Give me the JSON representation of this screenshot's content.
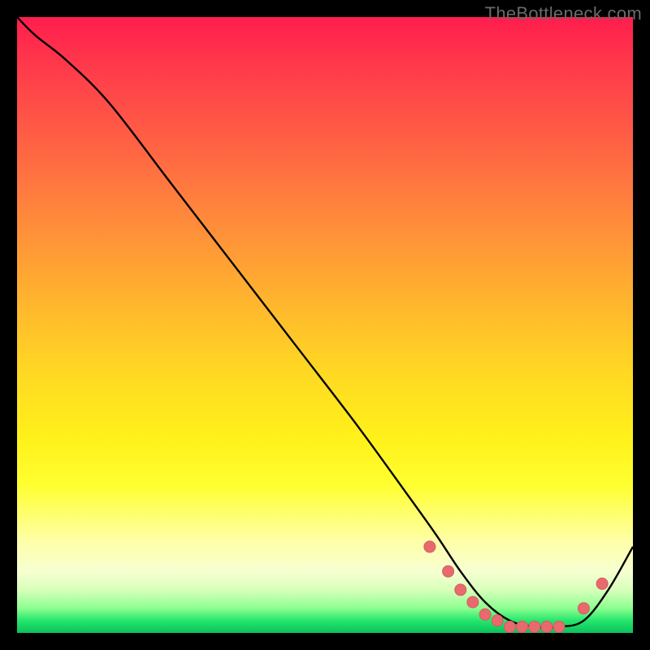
{
  "watermark": "TheBottleneck.com",
  "colors": {
    "background": "#000000",
    "watermark_text": "#6a6a6a",
    "curve_stroke": "#000000",
    "marker_fill": "#e86a6e",
    "marker_stroke": "#d95a5e"
  },
  "chart_data": {
    "type": "line",
    "title": "",
    "xlabel": "",
    "ylabel": "",
    "xlim": [
      0,
      100
    ],
    "ylim": [
      0,
      100
    ],
    "x": [
      0,
      3,
      8,
      15,
      25,
      35,
      45,
      55,
      63,
      68,
      72,
      76,
      80,
      84,
      88,
      92,
      96,
      100
    ],
    "y": [
      100,
      97,
      93,
      86,
      73,
      60,
      47,
      34,
      23,
      16,
      10,
      5,
      2,
      1,
      1,
      2,
      7,
      14
    ],
    "markers_x": [
      67,
      70,
      72,
      74,
      76,
      78,
      80,
      82,
      84,
      86,
      88,
      92,
      95
    ],
    "markers_y": [
      14,
      10,
      7,
      5,
      3,
      2,
      1,
      1,
      1,
      1,
      1,
      4,
      8
    ],
    "notes": "Axes have no visible tick labels; values are normalized 0–100. Curve descends steeply from top-left, flattens near bottom around x≈75–90, then rises toward bottom-right. Pink circular markers cluster along the trough."
  }
}
